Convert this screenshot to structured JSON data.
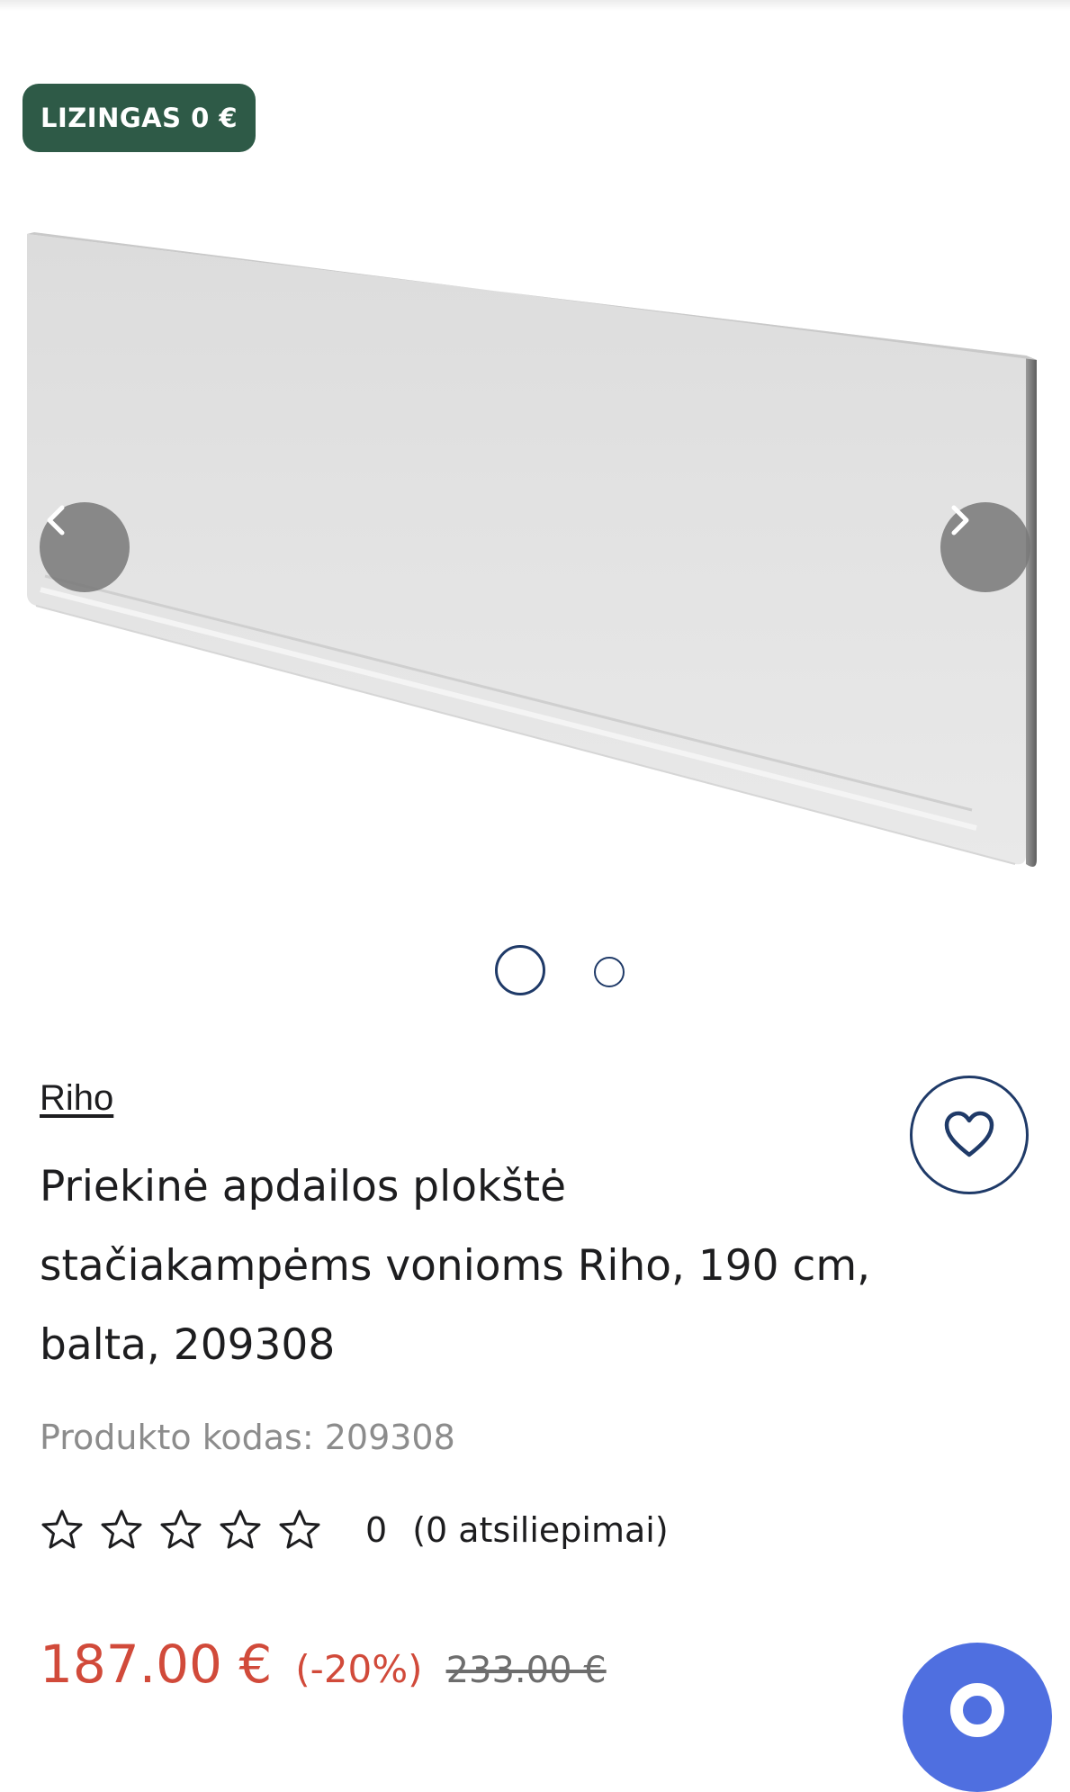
{
  "badge": {
    "label": "LIZINGAS 0 €"
  },
  "gallery": {
    "image_alt": "Bath front panel",
    "prev_icon": "chevron-left-icon",
    "next_icon": "chevron-right-icon",
    "slide_count": 2,
    "active_slide": 1
  },
  "product": {
    "brand": "Riho",
    "title": "Priekinė apdailos plokštė stačiakampėms vonioms Riho, 190 cm, balta, 209308",
    "code_label": "Produkto kodas: 209308",
    "rating": {
      "stars": 0,
      "max_stars": 5,
      "count": "0",
      "reviews": "(0 atsiliepimai)"
    },
    "price": "187.00 €",
    "discount": "(-20%)",
    "old_price": "233.00 €"
  },
  "actions": {
    "favorite_icon": "heart-icon",
    "chat_icon": "chat-icon"
  },
  "colors": {
    "badge_bg": "#2e5a47",
    "accent_navy": "#1f3a68",
    "price_red": "#d14a3a",
    "chat_blue": "#4f6fe0"
  }
}
